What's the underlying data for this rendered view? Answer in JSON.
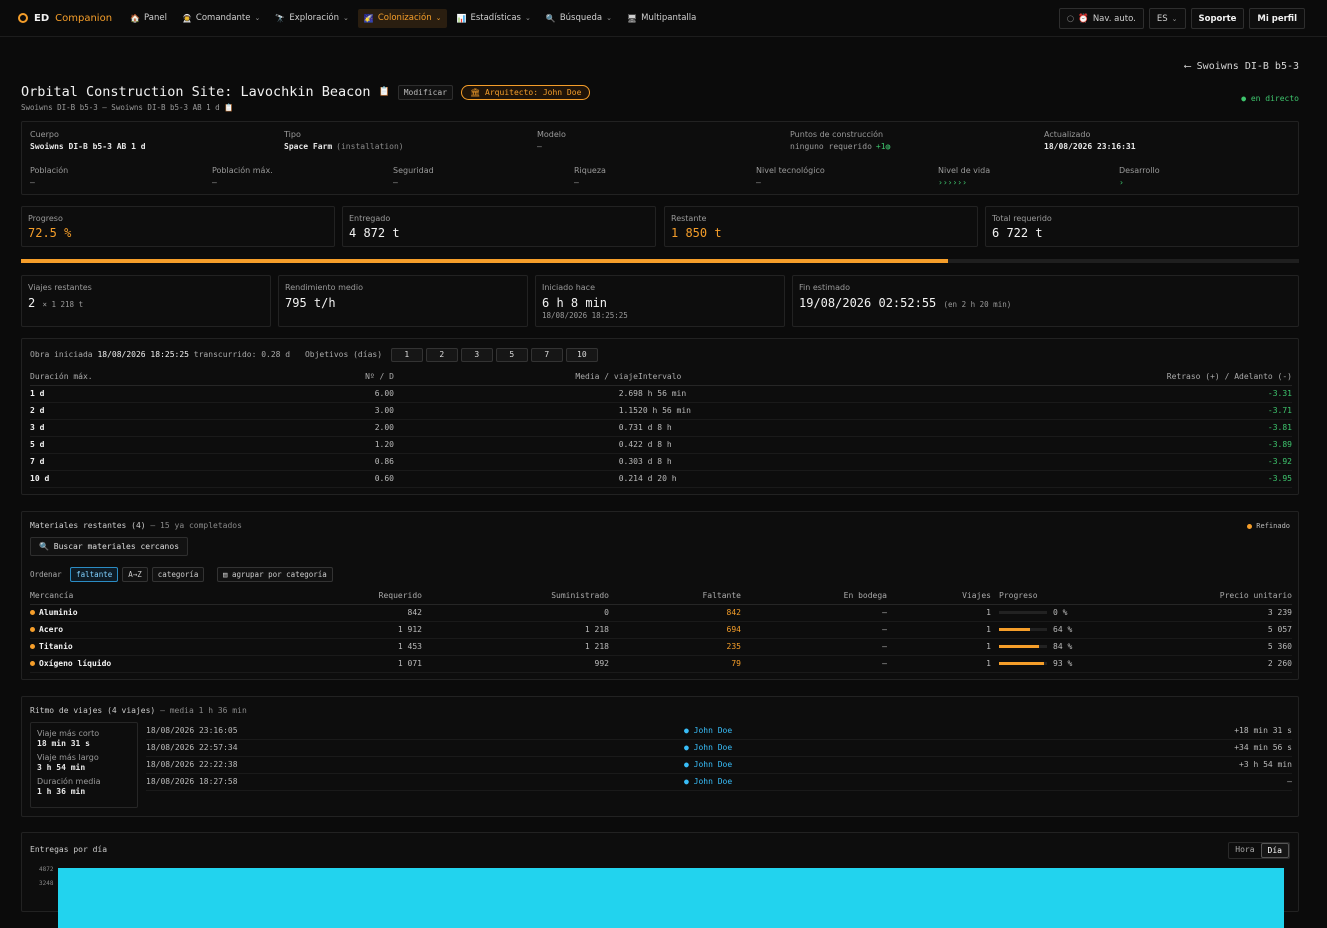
{
  "nav": {
    "logo_a": "ED",
    "logo_b": "Companion",
    "items": [
      {
        "icon": "🏠",
        "label": "Panel",
        "chevron": false,
        "active": false
      },
      {
        "icon": "👨‍🚀",
        "label": "Comandante",
        "chevron": true,
        "active": false
      },
      {
        "icon": "🔭",
        "label": "Exploración",
        "chevron": true,
        "active": false
      },
      {
        "icon": "🌠",
        "label": "Colonización",
        "chevron": true,
        "active": true
      },
      {
        "icon": "📊",
        "label": "Estadísticas",
        "chevron": true,
        "active": false
      },
      {
        "icon": "🔍",
        "label": "Búsqueda",
        "chevron": true,
        "active": false
      },
      {
        "icon": "🖥",
        "label": "Multipantalla",
        "chevron": false,
        "active": false
      }
    ],
    "nav_auto": "Nav. auto.",
    "lang": "ES",
    "support": "Soporte",
    "profile": "Mi perfil"
  },
  "header": {
    "back": "⟵ Swoiwns DI-B b5-3",
    "title": "Orbital Construction Site: Lavochkin Beacon",
    "edit": "Modificar",
    "architect": "🏛 Arquitecto: John Doe",
    "subtitle": "Swoiwns DI-B b5-3 — Swoiwns DI-B b5-3 AB 1 d",
    "live": "● en directo"
  },
  "info": {
    "row1": [
      {
        "label": "Cuerpo",
        "value": "Swoiwns DI-B b5-3 AB 1 d",
        "bold": true
      },
      {
        "label": "Tipo",
        "value": "Space Farm",
        "extra": "(installation)",
        "bold": true
      },
      {
        "label": "Modelo",
        "value": "–",
        "bold": false
      },
      {
        "label": "Puntos de construcción",
        "value": "ninguno requerido",
        "extra": "+1",
        "bold": false
      },
      {
        "label": "Actualizado",
        "value": "18/08/2026 23:16:31",
        "bold": true
      }
    ],
    "row2": [
      {
        "label": "Población",
        "value": "–"
      },
      {
        "label": "Población máx.",
        "value": "–"
      },
      {
        "label": "Seguridad",
        "value": "–"
      },
      {
        "label": "Riqueza",
        "value": "–"
      },
      {
        "label": "Nivel tecnológico",
        "value": "–"
      },
      {
        "label": "Nivel de vida",
        "value": "››››››"
      },
      {
        "label": "Desarrollo",
        "value": "›"
      }
    ]
  },
  "stats": [
    {
      "label": "Progreso",
      "value": "72.5 %",
      "orange": true
    },
    {
      "label": "Entregado",
      "value": "4 872 t",
      "orange": false
    },
    {
      "label": "Restante",
      "value": "1 850 t",
      "orange": true
    },
    {
      "label": "Total requerido",
      "value": "6 722 t",
      "orange": false
    }
  ],
  "progress": {
    "fraction": 0.725
  },
  "stats2": {
    "trips_label": "Viajes restantes",
    "trips_value": "2",
    "trips_extra": "× 1 218 t",
    "rate_label": "Rendimiento medio",
    "rate_value": "795 t/h",
    "started_label": "Iniciado hace",
    "started_value": "6 h 8 min",
    "started_date": "18/08/2026 18:25:25",
    "end_label": "Fin estimado",
    "end_value": "19/08/2026 02:52:55",
    "end_extra": "(en 2 h 20 min)"
  },
  "objectives": {
    "started_prefix": "Obra iniciada",
    "started_date": "18/08/2026 18:25:25",
    "elapsed": "transcurrido: 0.28 d",
    "objectives_label": "Objetivos (días)",
    "buttons": [
      "1",
      "2",
      "3",
      "5",
      "7",
      "10"
    ],
    "headers": [
      "Duración máx.",
      "Nº / D",
      "Media / viaje",
      "Intervalo",
      "Retraso (+) / Adelanto (-)"
    ],
    "rows": [
      [
        "1 d",
        "6.00",
        "2.69",
        "8 h 56 min",
        "-3.31"
      ],
      [
        "2 d",
        "3.00",
        "1.15",
        "20 h 56 min",
        "-3.71"
      ],
      [
        "3 d",
        "2.00",
        "0.73",
        "1 d 8 h",
        "-3.81"
      ],
      [
        "5 d",
        "1.20",
        "0.42",
        "2 d 8 h",
        "-3.89"
      ],
      [
        "7 d",
        "0.86",
        "0.30",
        "3 d 8 h",
        "-3.92"
      ],
      [
        "10 d",
        "0.60",
        "0.21",
        "4 d 20 h",
        "-3.95"
      ]
    ]
  },
  "materials": {
    "title": "Materiales restantes (4)",
    "completed": "— 15 ya completados",
    "refined": "Refinado",
    "search_btn": "🔍  Buscar materiales cercanos",
    "sort_label": "Ordenar",
    "sorts": [
      "faltante",
      "A→Z",
      "categoría"
    ],
    "group": "▤ agrupar por categoría",
    "headers": [
      "Mercancía",
      "Requerido",
      "Suministrado",
      "Faltante",
      "En bodega",
      "Viajes",
      "Progreso",
      "Precio unitario"
    ],
    "rows": [
      {
        "name": "Aluminio",
        "req": "842",
        "sup": "0",
        "miss": "842",
        "hold": "–",
        "trips": "1",
        "pct": "0 %",
        "frac": 0,
        "price": "3 239"
      },
      {
        "name": "Acero",
        "req": "1 912",
        "sup": "1 218",
        "miss": "694",
        "hold": "–",
        "trips": "1",
        "pct": "64 %",
        "frac": 0.64,
        "price": "5 057"
      },
      {
        "name": "Titanio",
        "req": "1 453",
        "sup": "1 218",
        "miss": "235",
        "hold": "–",
        "trips": "1",
        "pct": "84 %",
        "frac": 0.84,
        "price": "5 360"
      },
      {
        "name": "Oxígeno líquido",
        "req": "1 071",
        "sup": "992",
        "miss": "79",
        "hold": "–",
        "trips": "1",
        "pct": "93 %",
        "frac": 0.93,
        "price": "2 260"
      }
    ]
  },
  "rhythm": {
    "title": "Ritmo de viajes (4 viajes)",
    "avg": "— media 1 h 36 min",
    "shortest_label": "Viaje más corto",
    "shortest": "18 min 31 s",
    "longest_label": "Viaje más largo",
    "longest": "3 h 54 min",
    "average_label": "Duración media",
    "average": "1 h 36 min",
    "rows": [
      [
        "18/08/2026 23:16:05",
        "John Doe",
        "+18 min 31 s"
      ],
      [
        "18/08/2026 22:57:34",
        "John Doe",
        "+34 min 56 s"
      ],
      [
        "18/08/2026 22:22:38",
        "John Doe",
        "+3 h 54 min"
      ],
      [
        "18/08/2026 18:27:58",
        "John Doe",
        "–"
      ]
    ]
  },
  "deliveries": {
    "title": "Entregas por día",
    "toggle": [
      "Hora",
      "Día"
    ],
    "ytick_top": "4872",
    "ytick_2": "3248"
  },
  "colors": {
    "accent": "#f59e2a",
    "bar": "#22d3ee",
    "positive": "#3ec46d"
  }
}
